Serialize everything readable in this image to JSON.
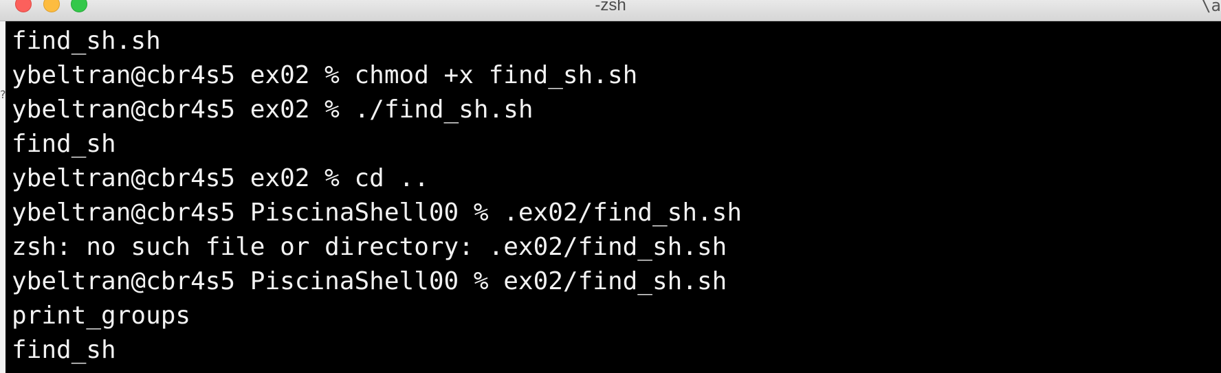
{
  "window": {
    "title": "-zsh",
    "corner_glyph": "\\a",
    "stray_mark": "?"
  },
  "terminal": {
    "lines": [
      "find_sh.sh",
      "ybeltran@cbr4s5 ex02 % chmod +x find_sh.sh",
      "ybeltran@cbr4s5 ex02 % ./find_sh.sh",
      "find_sh",
      "ybeltran@cbr4s5 ex02 % cd ..",
      "ybeltran@cbr4s5 PiscinaShell00 % .ex02/find_sh.sh",
      "zsh: no such file or directory: .ex02/find_sh.sh",
      "ybeltran@cbr4s5 PiscinaShell00 % ex02/find_sh.sh",
      "print_groups",
      "find_sh"
    ]
  },
  "colors": {
    "terminal_background": "#000000",
    "terminal_text": "#f2f2f2",
    "close_button": "#fc605c",
    "minimize_button": "#fdbc40",
    "maximize_button": "#34c84a"
  }
}
